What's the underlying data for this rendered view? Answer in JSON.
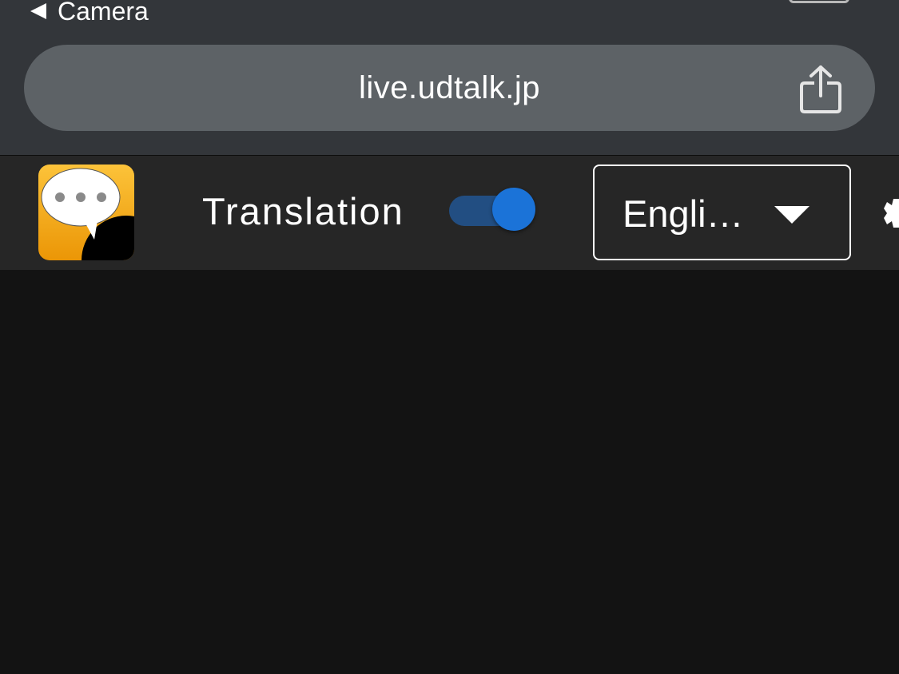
{
  "status_bar": {
    "back_label": "Camera"
  },
  "browser": {
    "url": "live.udtalk.jp",
    "share_icon": "share-icon"
  },
  "toolbar": {
    "logo_icon": "udtalk-logo-icon",
    "translation_label": "Translation",
    "translation_enabled": true,
    "language_value": "Engli…",
    "dropdown_icon": "chevron-down-icon",
    "settings_icon": "gear-icon"
  },
  "colors": {
    "chrome_bg": "#33363a",
    "url_bar_bg": "#5d6266",
    "toolbar_bg": "#262626",
    "content_bg": "#131313",
    "toggle_accent": "#1b73d8",
    "logo_orange": "#f5a623"
  }
}
